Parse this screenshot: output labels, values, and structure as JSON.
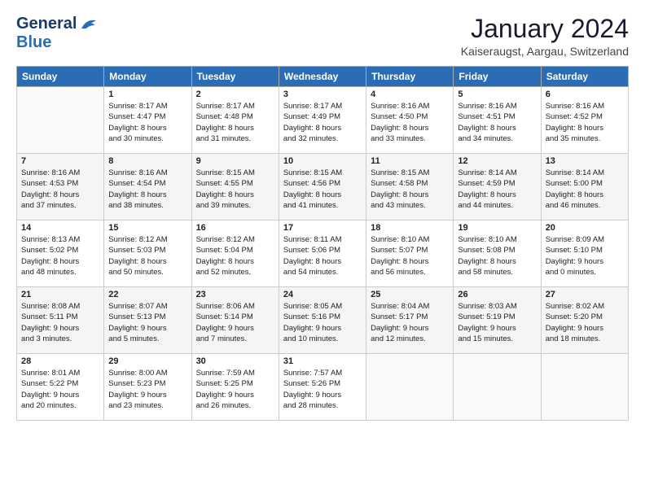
{
  "logo": {
    "line1": "General",
    "line2": "Blue"
  },
  "title": "January 2024",
  "location": "Kaiseraugst, Aargau, Switzerland",
  "weekdays": [
    "Sunday",
    "Monday",
    "Tuesday",
    "Wednesday",
    "Thursday",
    "Friday",
    "Saturday"
  ],
  "weeks": [
    [
      {
        "day": "",
        "info": ""
      },
      {
        "day": "1",
        "info": "Sunrise: 8:17 AM\nSunset: 4:47 PM\nDaylight: 8 hours\nand 30 minutes."
      },
      {
        "day": "2",
        "info": "Sunrise: 8:17 AM\nSunset: 4:48 PM\nDaylight: 8 hours\nand 31 minutes."
      },
      {
        "day": "3",
        "info": "Sunrise: 8:17 AM\nSunset: 4:49 PM\nDaylight: 8 hours\nand 32 minutes."
      },
      {
        "day": "4",
        "info": "Sunrise: 8:16 AM\nSunset: 4:50 PM\nDaylight: 8 hours\nand 33 minutes."
      },
      {
        "day": "5",
        "info": "Sunrise: 8:16 AM\nSunset: 4:51 PM\nDaylight: 8 hours\nand 34 minutes."
      },
      {
        "day": "6",
        "info": "Sunrise: 8:16 AM\nSunset: 4:52 PM\nDaylight: 8 hours\nand 35 minutes."
      }
    ],
    [
      {
        "day": "7",
        "info": "Sunrise: 8:16 AM\nSunset: 4:53 PM\nDaylight: 8 hours\nand 37 minutes."
      },
      {
        "day": "8",
        "info": "Sunrise: 8:16 AM\nSunset: 4:54 PM\nDaylight: 8 hours\nand 38 minutes."
      },
      {
        "day": "9",
        "info": "Sunrise: 8:15 AM\nSunset: 4:55 PM\nDaylight: 8 hours\nand 39 minutes."
      },
      {
        "day": "10",
        "info": "Sunrise: 8:15 AM\nSunset: 4:56 PM\nDaylight: 8 hours\nand 41 minutes."
      },
      {
        "day": "11",
        "info": "Sunrise: 8:15 AM\nSunset: 4:58 PM\nDaylight: 8 hours\nand 43 minutes."
      },
      {
        "day": "12",
        "info": "Sunrise: 8:14 AM\nSunset: 4:59 PM\nDaylight: 8 hours\nand 44 minutes."
      },
      {
        "day": "13",
        "info": "Sunrise: 8:14 AM\nSunset: 5:00 PM\nDaylight: 8 hours\nand 46 minutes."
      }
    ],
    [
      {
        "day": "14",
        "info": "Sunrise: 8:13 AM\nSunset: 5:02 PM\nDaylight: 8 hours\nand 48 minutes."
      },
      {
        "day": "15",
        "info": "Sunrise: 8:12 AM\nSunset: 5:03 PM\nDaylight: 8 hours\nand 50 minutes."
      },
      {
        "day": "16",
        "info": "Sunrise: 8:12 AM\nSunset: 5:04 PM\nDaylight: 8 hours\nand 52 minutes."
      },
      {
        "day": "17",
        "info": "Sunrise: 8:11 AM\nSunset: 5:06 PM\nDaylight: 8 hours\nand 54 minutes."
      },
      {
        "day": "18",
        "info": "Sunrise: 8:10 AM\nSunset: 5:07 PM\nDaylight: 8 hours\nand 56 minutes."
      },
      {
        "day": "19",
        "info": "Sunrise: 8:10 AM\nSunset: 5:08 PM\nDaylight: 8 hours\nand 58 minutes."
      },
      {
        "day": "20",
        "info": "Sunrise: 8:09 AM\nSunset: 5:10 PM\nDaylight: 9 hours\nand 0 minutes."
      }
    ],
    [
      {
        "day": "21",
        "info": "Sunrise: 8:08 AM\nSunset: 5:11 PM\nDaylight: 9 hours\nand 3 minutes."
      },
      {
        "day": "22",
        "info": "Sunrise: 8:07 AM\nSunset: 5:13 PM\nDaylight: 9 hours\nand 5 minutes."
      },
      {
        "day": "23",
        "info": "Sunrise: 8:06 AM\nSunset: 5:14 PM\nDaylight: 9 hours\nand 7 minutes."
      },
      {
        "day": "24",
        "info": "Sunrise: 8:05 AM\nSunset: 5:16 PM\nDaylight: 9 hours\nand 10 minutes."
      },
      {
        "day": "25",
        "info": "Sunrise: 8:04 AM\nSunset: 5:17 PM\nDaylight: 9 hours\nand 12 minutes."
      },
      {
        "day": "26",
        "info": "Sunrise: 8:03 AM\nSunset: 5:19 PM\nDaylight: 9 hours\nand 15 minutes."
      },
      {
        "day": "27",
        "info": "Sunrise: 8:02 AM\nSunset: 5:20 PM\nDaylight: 9 hours\nand 18 minutes."
      }
    ],
    [
      {
        "day": "28",
        "info": "Sunrise: 8:01 AM\nSunset: 5:22 PM\nDaylight: 9 hours\nand 20 minutes."
      },
      {
        "day": "29",
        "info": "Sunrise: 8:00 AM\nSunset: 5:23 PM\nDaylight: 9 hours\nand 23 minutes."
      },
      {
        "day": "30",
        "info": "Sunrise: 7:59 AM\nSunset: 5:25 PM\nDaylight: 9 hours\nand 26 minutes."
      },
      {
        "day": "31",
        "info": "Sunrise: 7:57 AM\nSunset: 5:26 PM\nDaylight: 9 hours\nand 28 minutes."
      },
      {
        "day": "",
        "info": ""
      },
      {
        "day": "",
        "info": ""
      },
      {
        "day": "",
        "info": ""
      }
    ]
  ]
}
